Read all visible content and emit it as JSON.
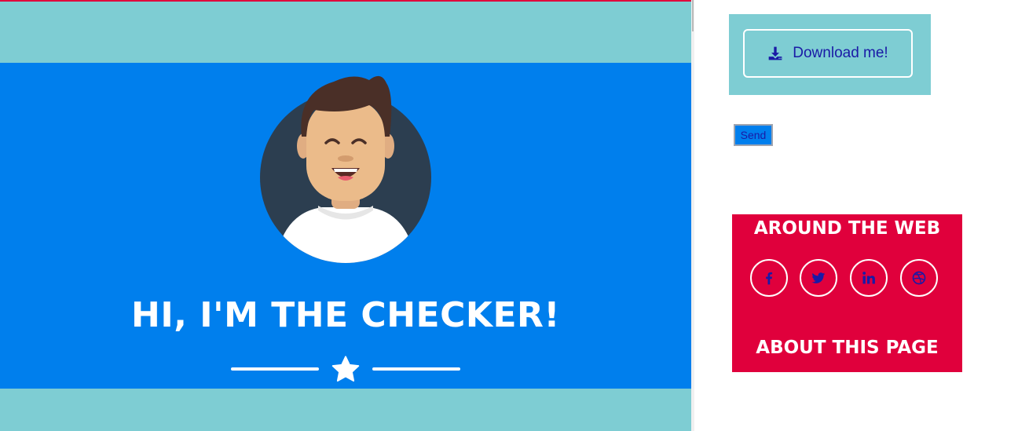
{
  "hero": {
    "title": "HI, I'M THE CHECKER!"
  },
  "download": {
    "label": "Download me!",
    "icon": "download-icon"
  },
  "form": {
    "send_label": "Send"
  },
  "social": {
    "heading": "AROUND THE WEB",
    "links": [
      {
        "icon": "facebook-icon"
      },
      {
        "icon": "twitter-icon"
      },
      {
        "icon": "linkedin-icon"
      },
      {
        "icon": "dribbble-icon"
      }
    ],
    "about_heading": "ABOUT THIS PAGE"
  },
  "colors": {
    "teal": "#7ecdd3",
    "hero_blue": "#007fed",
    "accent_red": "#e0003c",
    "link_blue": "#1a1aa6"
  }
}
